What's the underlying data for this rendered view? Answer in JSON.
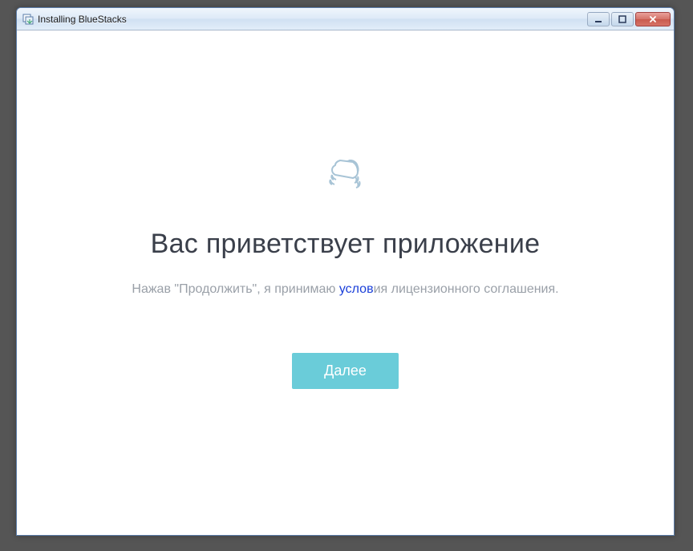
{
  "titlebar": {
    "title": "Installing BlueStacks"
  },
  "content": {
    "heading": "Вас приветствует приложение",
    "subtext_before": "Нажав \"Продолжить\", я принимаю ",
    "subtext_link": "услов",
    "subtext_after": "ия лицензионного соглашения.",
    "next_button": "Далее"
  },
  "colors": {
    "accent": "#6accd9",
    "link": "#1a3fd9",
    "heading": "#3a3f4a",
    "muted": "#9aa0a8"
  }
}
